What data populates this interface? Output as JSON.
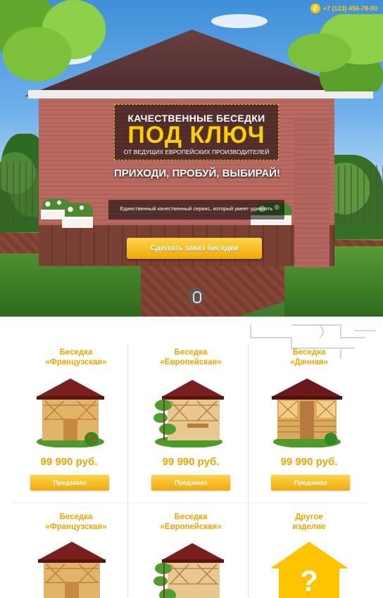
{
  "header": {
    "phone": "+7 (123) 456-78-90",
    "phone_icon": "phone-icon"
  },
  "hero": {
    "title_line1": "КАЧЕСТВЕННЫЕ БЕСЕДКИ",
    "title_line2": "ПОД КЛЮЧ",
    "title_line3": "ОТ ВЕДУЩИХ ЕВРОПЕЙСКИХ ПРОИЗВОДИТЕЛЕЙ",
    "slogan": "ПРИХОДИ, ПРОБУЙ, ВЫБИРАЙ!",
    "description": "Единственный качественный сервис, который умеет удивлять",
    "cta_label": "Сделать заказ беседки"
  },
  "colors": {
    "accent": "#f0a500",
    "button": "#ffc107"
  },
  "products": [
    {
      "title_1": "Беседка",
      "title_2": "«Французская»",
      "price": "99 990 руб.",
      "button": "Предзаказ"
    },
    {
      "title_1": "Беседка",
      "title_2": "«Европейская»",
      "price": "99 990 руб.",
      "button": "Предзаказ"
    },
    {
      "title_1": "Беседка",
      "title_2": "«Дачная»",
      "price": "99 990 руб.",
      "button": "Предзаказ"
    },
    {
      "title_1": "Беседка",
      "title_2": "«Французская»"
    },
    {
      "title_1": "Беседка",
      "title_2": "«Европейская»"
    },
    {
      "title_1": "Другое",
      "title_2": "изделие",
      "icon": "question-house-icon"
    }
  ]
}
